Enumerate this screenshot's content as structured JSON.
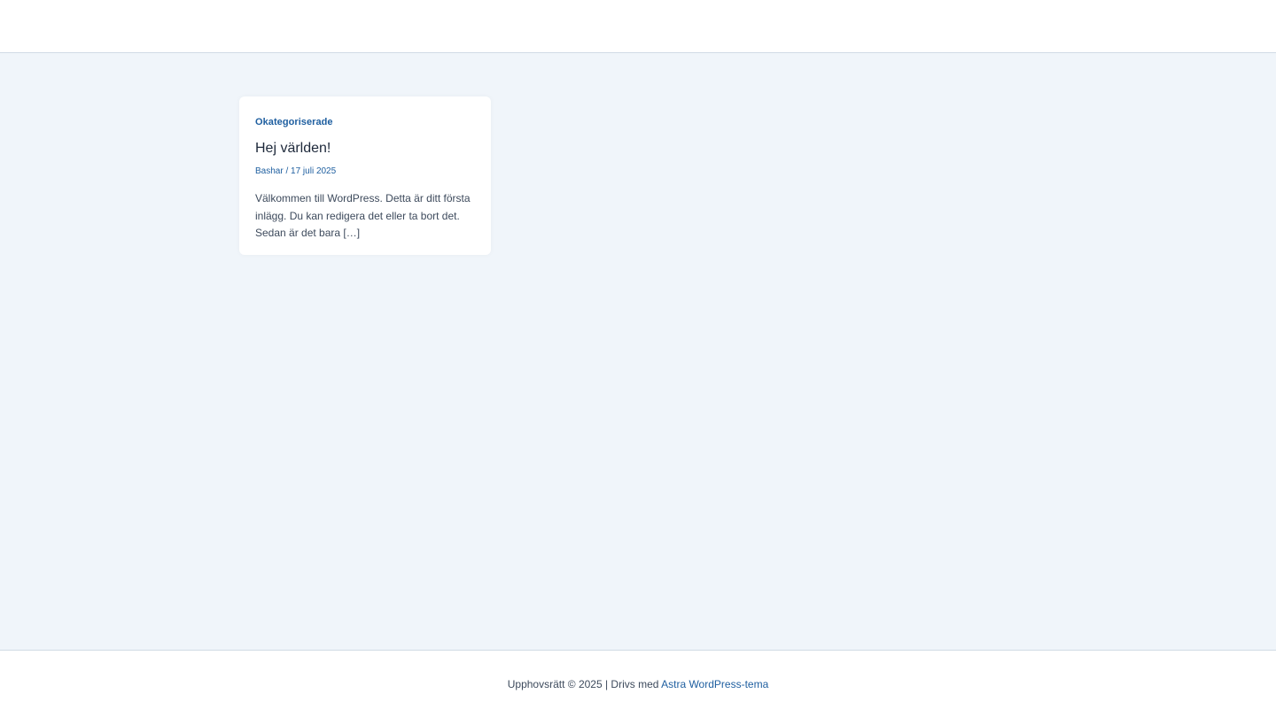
{
  "post": {
    "category": "Okategoriserade",
    "title": "Hej världen!",
    "author": "Bashar",
    "meta_separator": "/",
    "date": "17 juli 2025",
    "excerpt": "Välkommen till WordPress. Detta är ditt första inlägg. Du kan redigera det eller ta bort det. Sedan är det bara […]"
  },
  "footer": {
    "copyright_text": "Upphovsrätt © 2025 | Drivs med ",
    "theme_link": "Astra WordPress-tema"
  },
  "colors": {
    "background": "#f0f5fa",
    "accent": "#1f5fa0",
    "text": "#3d4a5c",
    "heading": "#1e293b"
  }
}
